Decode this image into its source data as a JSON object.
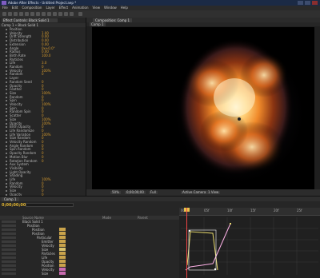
{
  "window": {
    "title": "Adobe After Effects - Untitled Project.aep *"
  },
  "menu": [
    "File",
    "Edit",
    "Composition",
    "Layer",
    "Effect",
    "Animation",
    "View",
    "Window",
    "Help"
  ],
  "effect_controls": {
    "tab_label": "Effect Controls: Black Solid 1",
    "subtitle": "Comp 1 • Black Solid 1",
    "rows": [
      {
        "name": "Position",
        "value": ""
      },
      {
        "name": "Velocity",
        "value": "1.00"
      },
      {
        "name": "Drift Strength",
        "value": "0.00"
      },
      {
        "name": "Distribution",
        "value": "0.00"
      },
      {
        "name": "Extension",
        "value": "0.00"
      },
      {
        "name": "Angle",
        "value": "0x+0.0°"
      },
      {
        "name": "Radius",
        "value": "0.00"
      },
      {
        "name": "Birth Rate",
        "value": "100.0"
      },
      {
        "name": "Particles",
        "value": ""
      },
      {
        "name": "Life",
        "value": "3.0"
      },
      {
        "name": "Random",
        "value": "0"
      },
      {
        "name": "Velocity",
        "value": "100%"
      },
      {
        "name": "Random",
        "value": "0"
      },
      {
        "name": "Layer",
        "value": ""
      },
      {
        "name": "Random Seed",
        "value": "0"
      },
      {
        "name": "Opacity",
        "value": "0"
      },
      {
        "name": "Feather",
        "value": "0"
      },
      {
        "name": "Size",
        "value": "100%"
      },
      {
        "name": "Random",
        "value": "0"
      },
      {
        "name": "Spin",
        "value": "0"
      },
      {
        "name": "Velocity",
        "value": "100%"
      },
      {
        "name": "Spin",
        "value": "0"
      },
      {
        "name": "Random Spin",
        "value": "0"
      },
      {
        "name": "Scatter",
        "value": "0"
      },
      {
        "name": "Size",
        "value": "100%"
      },
      {
        "name": "Opacity",
        "value": "100%"
      },
      {
        "name": "Birth Opacity",
        "value": "0"
      },
      {
        "name": "Life Randomize",
        "value": "0"
      },
      {
        "name": "Life Variation",
        "value": "100%"
      },
      {
        "name": "Size Random",
        "value": "0"
      },
      {
        "name": "Velocity Random",
        "value": "0"
      },
      {
        "name": "Angle Random",
        "value": "0"
      },
      {
        "name": "Spin Random",
        "value": "0"
      },
      {
        "name": "Opacity Random",
        "value": "0"
      },
      {
        "name": "Motion Blur",
        "value": "0"
      },
      {
        "name": "Rotation Random",
        "value": "0"
      },
      {
        "name": "Aux System",
        "value": ""
      },
      {
        "name": "Visibility",
        "value": ""
      },
      {
        "name": "Light Opacity",
        "value": ""
      },
      {
        "name": "Shading",
        "value": ""
      },
      {
        "name": "Life",
        "value": "100%"
      },
      {
        "name": "Random",
        "value": "0"
      },
      {
        "name": "Velocity",
        "value": "0"
      },
      {
        "name": "Size",
        "value": "0"
      },
      {
        "name": "Opacity",
        "value": "0"
      }
    ]
  },
  "composition": {
    "tab_label": "Composition: Comp 1",
    "sub_tab": "Comp 1",
    "viewer_bar": [
      "50%",
      "0;00;00;00",
      "Full",
      "Active Camera",
      "1 View"
    ]
  },
  "timeline": {
    "tab_label": "Comp 1",
    "timecode": "0;00;00;00",
    "search_placeholder": "",
    "columns": {
      "source": "Source Name",
      "mode": "Mode",
      "parent": "Parent"
    },
    "ruler_ticks": [
      "00f",
      "05f",
      "10f",
      "15f",
      "20f",
      "25f"
    ],
    "layers": [
      {
        "name": "Black Solid 1",
        "value": "",
        "indent": 0
      },
      {
        "name": "Position",
        "value": "",
        "indent": 1
      },
      {
        "name": "Position",
        "value": "",
        "indent": 2
      },
      {
        "name": "Position",
        "value": "",
        "indent": 2
      },
      {
        "name": "Particular",
        "value": "",
        "indent": 3
      },
      {
        "name": "Emitter",
        "value": "",
        "indent": 4
      },
      {
        "name": "Velocity",
        "value": "",
        "indent": 4
      },
      {
        "name": "Size",
        "value": "",
        "indent": 4
      },
      {
        "name": "Particles",
        "value": "",
        "indent": 4
      },
      {
        "name": "Life",
        "value": "",
        "indent": 4
      },
      {
        "name": "Opacity",
        "value": "",
        "indent": 4
      },
      {
        "name": "Position",
        "value": "",
        "indent": 4
      },
      {
        "name": "Velocity",
        "value": "",
        "indent": 4
      },
      {
        "name": "Size",
        "value": "",
        "indent": 4
      }
    ],
    "label_colors": [
      "#c9a34b",
      "#c9a34b",
      "#c9a34b",
      "#c9a34b",
      "#c9a34b",
      "#d9c26b",
      "#c9a34b",
      "#c9a34b",
      "#c9a34b",
      "#c9a34b",
      "#c96bb0",
      "#c96bb0"
    ]
  }
}
